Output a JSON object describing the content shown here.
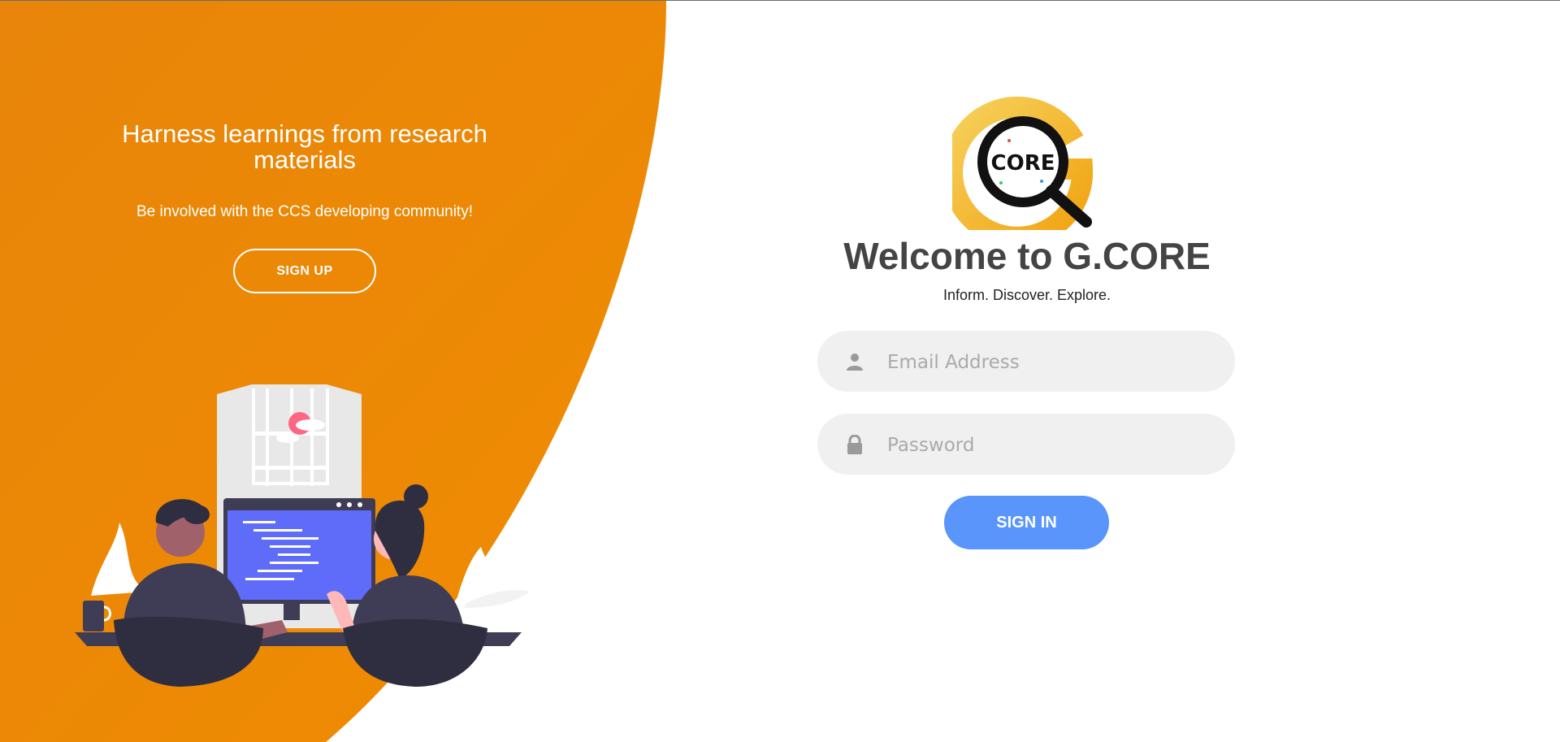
{
  "hero": {
    "heading": "Harness learnings from research materials",
    "subtext": "Be involved with the CCS developing community!",
    "signup_label": "SIGN UP"
  },
  "brand": {
    "logo_text": "CORE",
    "logo_letter": "G",
    "welcome": "Welcome to G.CORE",
    "tagline": "Inform. Discover. Explore."
  },
  "login": {
    "email_placeholder": "Email Address",
    "password_placeholder": "Password",
    "signin_label": "SIGN IN"
  },
  "icons": {
    "email": "user-icon",
    "password": "lock-icon"
  },
  "colors": {
    "orange": "#ee8a00",
    "accent_blue": "#5995fb",
    "field_bg": "#f0f0f0",
    "title": "#444444"
  }
}
